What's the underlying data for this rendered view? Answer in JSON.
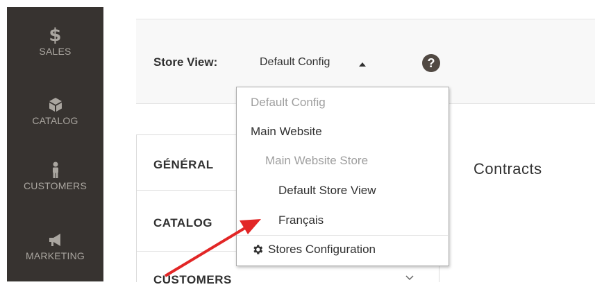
{
  "sidebar": {
    "items": [
      {
        "label": "SALES",
        "icon": "dollar-icon"
      },
      {
        "label": "CATALOG",
        "icon": "box-icon"
      },
      {
        "label": "CUSTOMERS",
        "icon": "person-icon"
      },
      {
        "label": "MARKETING",
        "icon": "megaphone-icon"
      }
    ],
    "sales_symbol": "$"
  },
  "header": {
    "store_view_label": "Store View:",
    "store_view_value": "Default Config",
    "help_symbol": "?"
  },
  "dropdown": {
    "items": [
      {
        "label": "Default Config",
        "level": 0,
        "muted": true
      },
      {
        "label": "Main Website",
        "level": 0,
        "muted": false
      },
      {
        "label": "Main Website Store",
        "level": 1,
        "muted": true
      },
      {
        "label": "Default Store View",
        "level": 2,
        "muted": false
      },
      {
        "label": "Français",
        "level": 2,
        "muted": false
      }
    ],
    "footer_label": "Stores Configuration"
  },
  "tabs": [
    "GÉNÉRAL",
    "CATALOG",
    "CUSTOMERS"
  ],
  "main": {
    "section_title": "Contracts"
  },
  "colors": {
    "sidebar_bg": "#373330",
    "sidebar_text": "#aaa6a0",
    "annotation_arrow": "#e22626"
  }
}
